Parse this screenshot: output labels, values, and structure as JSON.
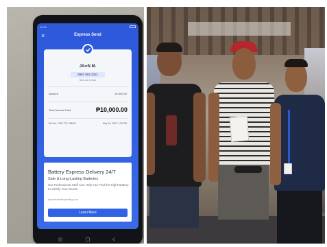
{
  "phone_screen": {
    "status_time": "10:20",
    "title": "Express Send",
    "recipient_name": "JA••N M.",
    "recipient_number": "0997 904 2021",
    "recipient_sub": "Sent via GCash",
    "amount_label": "Amount",
    "amount_value": "10,000.00",
    "total_label": "Total Amount Paid",
    "total_value": "₱10,000.00",
    "ref_text": "Ref No. 7009 772 198647",
    "date_text": "May 16, 2022 1:02 PM"
  },
  "ad_banner": {
    "title": "Battery Express Delivery 24/7",
    "subtitle": "Safe & Long-Lasting Batteries",
    "description": "Our Professional Staff Can Help You Find the Right Battery to Satisfy Your Needs.",
    "url": "bjurmetrobatterytrading.com",
    "button_label": "Learn More"
  },
  "colors": {
    "screen_blue": "#2f5ee0",
    "button_blue": "#2f62e6",
    "card_bg": "#f5f6fa"
  }
}
